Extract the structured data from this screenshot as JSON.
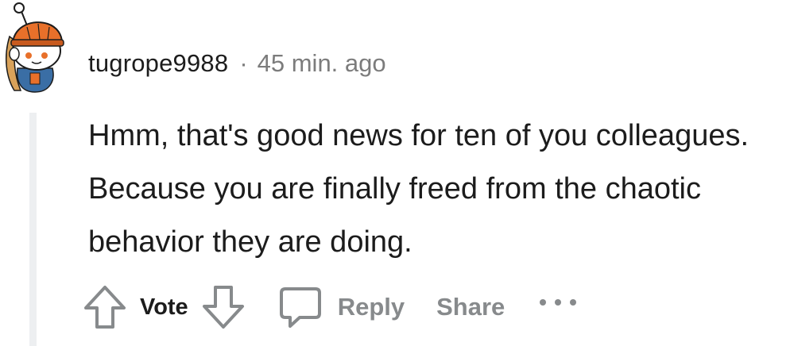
{
  "comment": {
    "username": "tugrope9988",
    "separator": "·",
    "timestamp": "45 min. ago",
    "body": "Hmm, that's good news for ten of you colleagues. Because you are finally freed from the chaotic behavior they are doing."
  },
  "actions": {
    "vote_label": "Vote",
    "reply_label": "Reply",
    "share_label": "Share"
  },
  "icons": {
    "avatar": "snoo-avatar",
    "upvote": "arrow-up-icon",
    "downvote": "arrow-down-icon",
    "reply": "speech-bubble-icon",
    "more": "more-horizontal-icon"
  },
  "colors": {
    "text": "#1c1c1c",
    "muted": "#878a8c",
    "thread_line": "#edeff1",
    "helmet": "#e8702a"
  }
}
